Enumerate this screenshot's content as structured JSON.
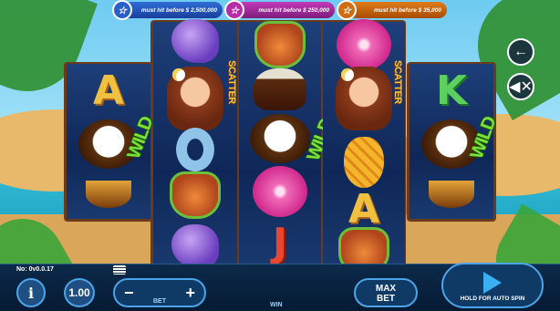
{
  "jackpots": [
    {
      "text": "must hit before $ 2,500,000",
      "color": "#2f6dd8",
      "icon": "star-icon"
    },
    {
      "text": "must hit before $ 250,000",
      "color": "#c23ab9",
      "icon": "star-icon"
    },
    {
      "text": "must hit before $ 35,000",
      "color": "#e07b19",
      "icon": "star-icon"
    }
  ],
  "reels": [
    [
      "A",
      "coconut",
      "bowl"
    ],
    [
      "shell",
      "girl",
      "wild",
      "ring",
      "mask",
      "shell"
    ],
    [
      "mask",
      "drum",
      "coconut",
      "flower",
      "J"
    ],
    [
      "flower",
      "girl",
      "scatter",
      "pineapple",
      "A",
      "mask"
    ],
    [
      "K",
      "coconut",
      "bowl"
    ]
  ],
  "symbols": {
    "A": "A",
    "K": "K",
    "J": "J",
    "wild": "WILD",
    "scatter": "SCATTER"
  },
  "controls": {
    "back_icon": "arrow-left-icon",
    "sound_icon": "sound-off-icon",
    "version": "No: 0v0.0.17",
    "info_label": "i",
    "coin_value": "1.00",
    "bet_minus": "−",
    "bet_plus": "+",
    "bet_label": "BET",
    "win_label": "WIN",
    "max_bet_label_1": "MAX",
    "max_bet_label_2": "BET",
    "spin_label": "HOLD FOR AUTO SPIN"
  }
}
